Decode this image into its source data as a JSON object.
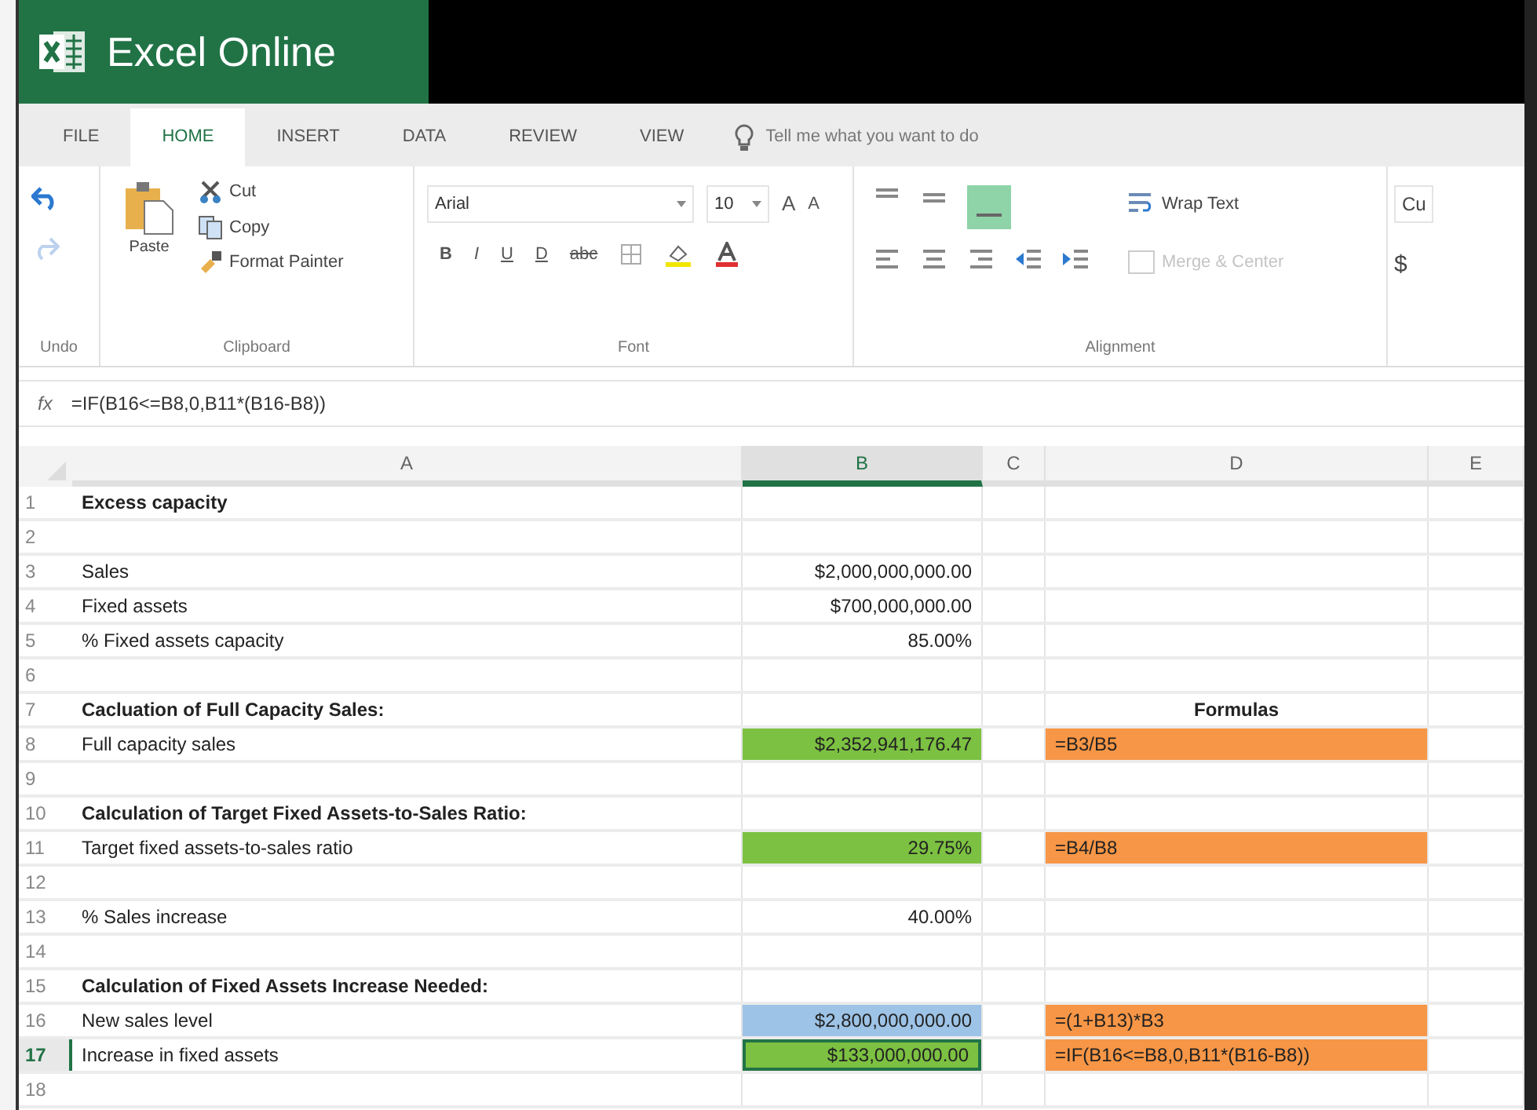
{
  "app": {
    "title": "Excel Online"
  },
  "tabs": [
    {
      "label": "FILE",
      "selected": false
    },
    {
      "label": "HOME",
      "selected": true
    },
    {
      "label": "INSERT",
      "selected": false
    },
    {
      "label": "DATA",
      "selected": false
    },
    {
      "label": "REVIEW",
      "selected": false
    },
    {
      "label": "VIEW",
      "selected": false
    }
  ],
  "tell_me": {
    "placeholder": "Tell me what you want to do"
  },
  "ribbon": {
    "undo": {
      "label": "Undo"
    },
    "clipboard": {
      "label": "Clipboard",
      "paste": "Paste",
      "cut": "Cut",
      "copy": "Copy",
      "format_painter": "Format Painter"
    },
    "font": {
      "label": "Font",
      "font_name": "Arial",
      "font_size": "10",
      "grow": "A",
      "shrink": "A",
      "styles": [
        "B",
        "I",
        "U",
        "D",
        "abc"
      ]
    },
    "alignment": {
      "label": "Alignment",
      "wrap_text": "Wrap Text",
      "merge_center": {
        "label": "Merge & Center",
        "disabled": true
      }
    },
    "number": {
      "format": "Cu",
      "currency": "$"
    }
  },
  "formula_bar": {
    "fx": "fx",
    "value": "=IF(B16<=B8,0,B11*(B16-B8))"
  },
  "columns": [
    {
      "label": "A",
      "selected": false
    },
    {
      "label": "B",
      "selected": true
    },
    {
      "label": "C",
      "selected": false
    },
    {
      "label": "D",
      "selected": false
    },
    {
      "label": "E",
      "selected": false
    }
  ],
  "rows": [
    {
      "number": "1",
      "selected": false,
      "a": {
        "text": "Excess capacity",
        "bold": true
      }
    },
    {
      "number": "2",
      "selected": false
    },
    {
      "number": "3",
      "selected": false,
      "a": {
        "text": "Sales",
        "bold": false
      },
      "b": {
        "text": "$2,000,000,000.00",
        "bold": false,
        "selected": false
      }
    },
    {
      "number": "4",
      "selected": false,
      "a": {
        "text": "Fixed assets",
        "bold": false
      },
      "b": {
        "text": "$700,000,000.00",
        "bold": false,
        "selected": false
      }
    },
    {
      "number": "5",
      "selected": false,
      "a": {
        "text": "% Fixed assets capacity",
        "bold": false
      },
      "b": {
        "text": "85.00%",
        "bold": false,
        "selected": false
      }
    },
    {
      "number": "6",
      "selected": false
    },
    {
      "number": "7",
      "selected": false,
      "a": {
        "text": "Cacluation of Full Capacity Sales:",
        "bold": true
      },
      "d": {
        "text": "Formulas",
        "bold": true
      }
    },
    {
      "number": "8",
      "selected": false,
      "a": {
        "text": "Full capacity sales",
        "bold": false
      },
      "b": {
        "text": "$2,352,941,176.47",
        "bold": false,
        "selected": false,
        "color": "#7cc142"
      },
      "d": {
        "text": "=B3/B5",
        "bold": false,
        "color": "#f79646"
      }
    },
    {
      "number": "9",
      "selected": false
    },
    {
      "number": "10",
      "selected": false,
      "a": {
        "text": "Calculation of Target Fixed Assets-to-Sales Ratio:",
        "bold": true
      }
    },
    {
      "number": "11",
      "selected": false,
      "a": {
        "text": "Target fixed assets-to-sales ratio",
        "bold": false
      },
      "b": {
        "text": "29.75%",
        "bold": false,
        "selected": false,
        "color": "#7cc142"
      },
      "d": {
        "text": "=B4/B8",
        "bold": false,
        "color": "#f79646"
      }
    },
    {
      "number": "12",
      "selected": false
    },
    {
      "number": "13",
      "selected": false,
      "a": {
        "text": "% Sales increase",
        "bold": false
      },
      "b": {
        "text": "40.00%",
        "bold": false,
        "selected": false
      }
    },
    {
      "number": "14",
      "selected": false
    },
    {
      "number": "15",
      "selected": false,
      "a": {
        "text": "Calculation of Fixed Assets Increase Needed:",
        "bold": true
      }
    },
    {
      "number": "16",
      "selected": false,
      "a": {
        "text": "New sales level",
        "bold": false
      },
      "b": {
        "text": "$2,800,000,000.00",
        "bold": false,
        "selected": false,
        "color": "#9dc3e6"
      },
      "d": {
        "text": "=(1+B13)*B3",
        "bold": false,
        "color": "#f79646"
      }
    },
    {
      "number": "17",
      "selected": true,
      "a": {
        "text": "Increase in fixed assets",
        "bold": false
      },
      "b": {
        "text": "$133,000,000.00",
        "bold": false,
        "selected": true,
        "color": "#7cc142"
      },
      "d": {
        "text": "=IF(B16<=B8,0,B11*(B16-B8))",
        "bold": false,
        "color": "#f79646"
      }
    },
    {
      "number": "18",
      "selected": false
    }
  ]
}
